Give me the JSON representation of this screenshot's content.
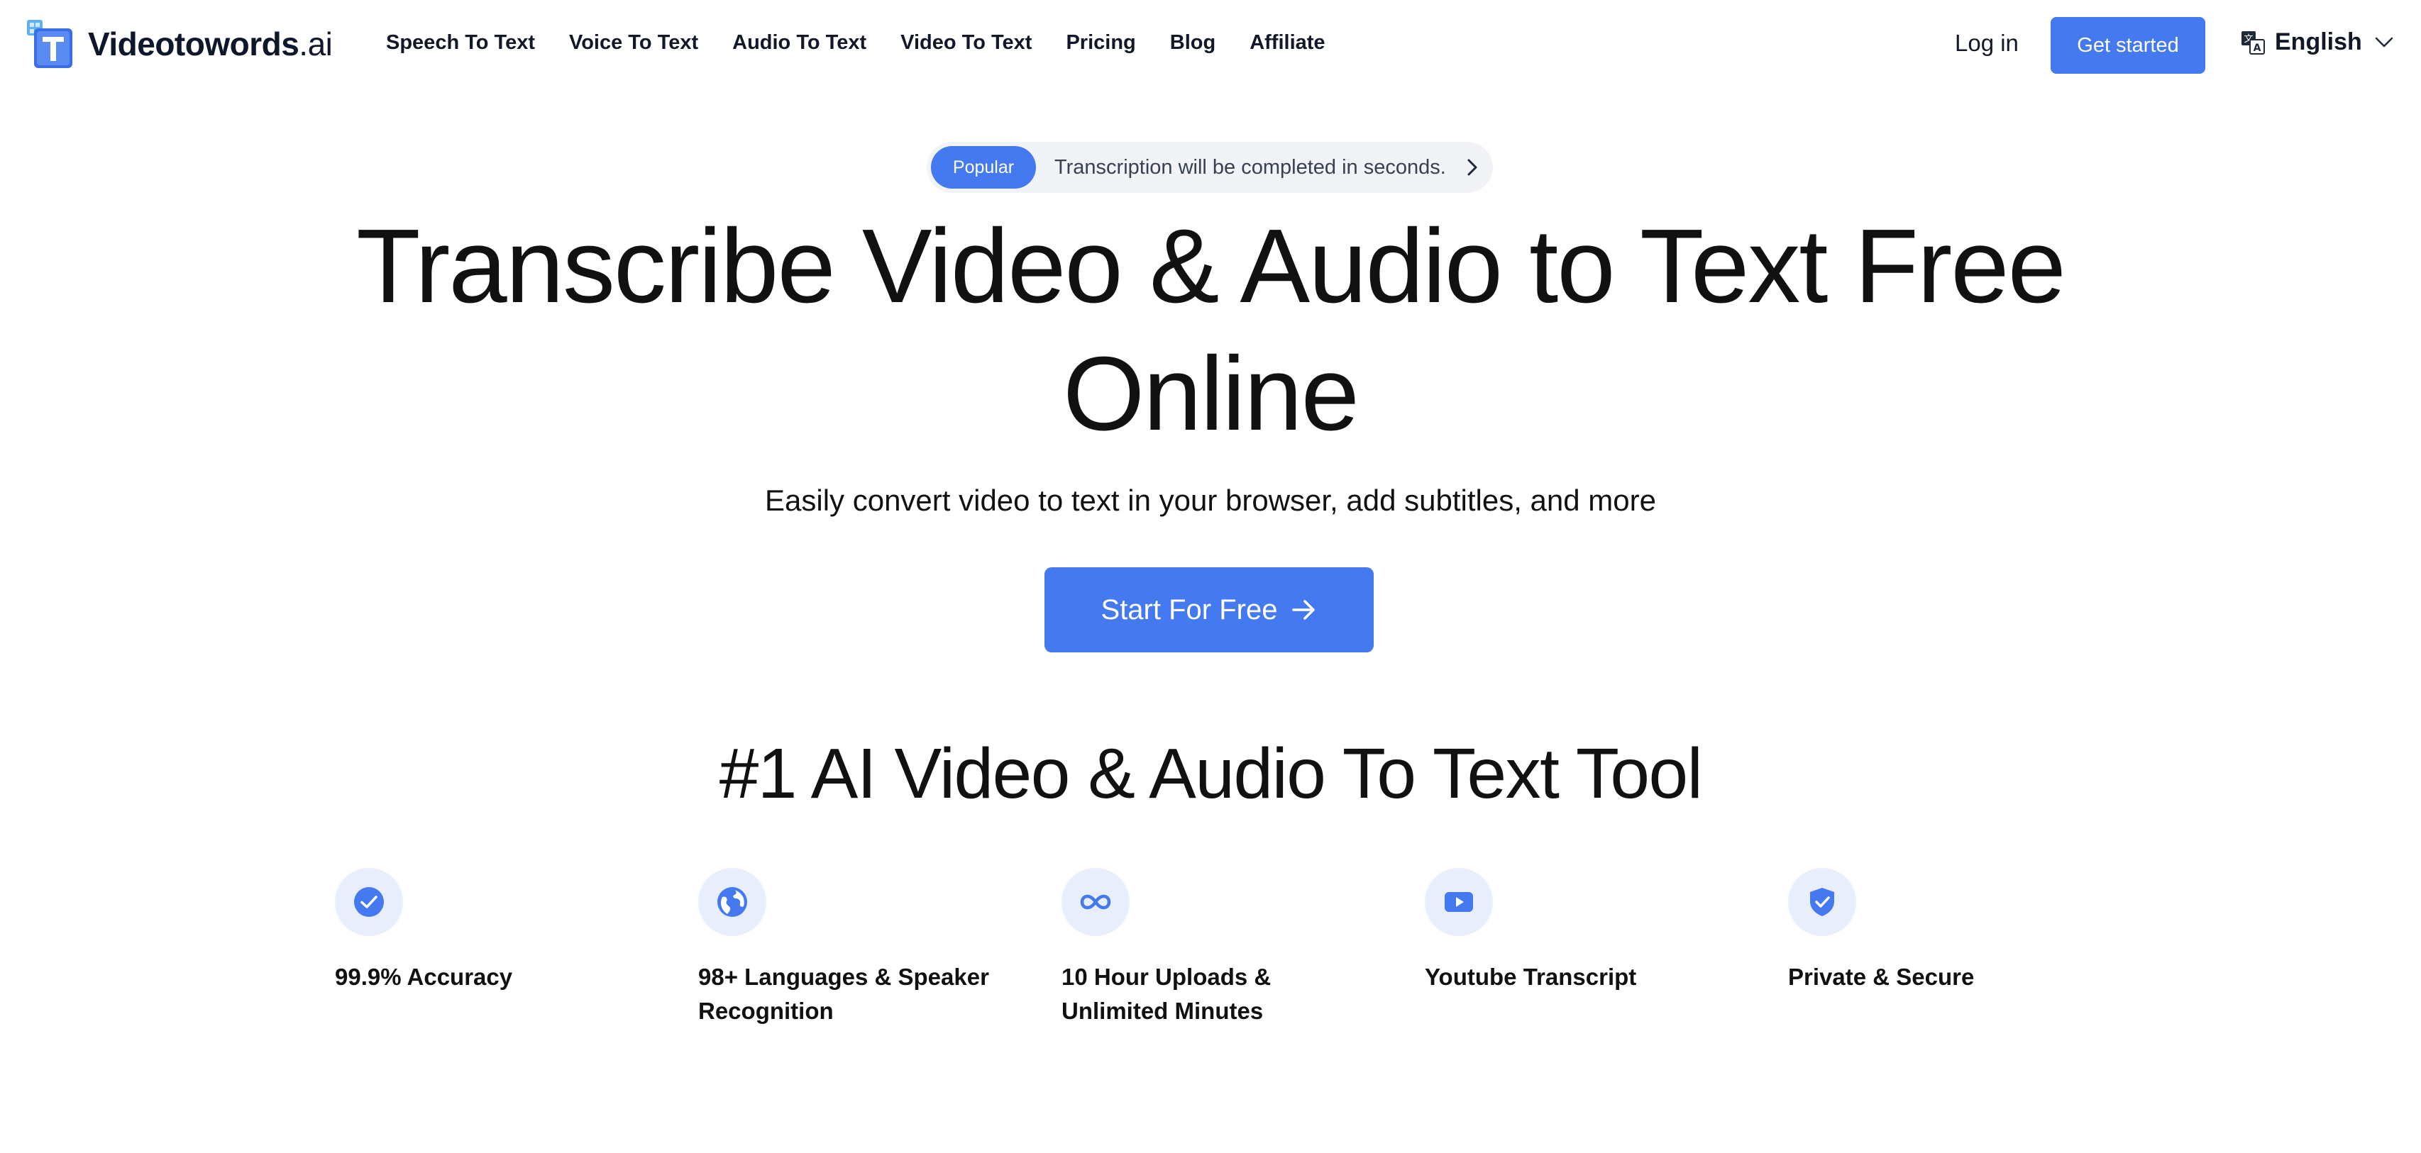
{
  "header": {
    "logo": {
      "name": "Videotowords",
      "suffix": ".ai"
    },
    "nav": [
      {
        "label": "Speech To Text"
      },
      {
        "label": "Voice To Text"
      },
      {
        "label": "Audio To Text"
      },
      {
        "label": "Video To Text"
      },
      {
        "label": "Pricing"
      },
      {
        "label": "Blog"
      },
      {
        "label": "Affiliate"
      }
    ],
    "login_label": "Log in",
    "get_started_label": "Get started",
    "language": {
      "icon": "translate-icon",
      "selected": "English"
    }
  },
  "hero": {
    "announcement": {
      "badge": "Popular",
      "text": "Transcription will be completed in seconds."
    },
    "title_line1": "Transcribe Video & Audio to Text Free",
    "title_line2": "Online",
    "subtitle": "Easily convert video to text in your browser, add subtitles, and more",
    "cta_label": "Start For Free"
  },
  "features_section": {
    "title": "#1 AI Video & Audio To Text Tool",
    "items": [
      {
        "icon": "check-circle-icon",
        "label_line1": "99.9% Accuracy",
        "label_line2": ""
      },
      {
        "icon": "globe-icon",
        "label_line1": "98+ Languages & Speaker",
        "label_line2": "Recognition"
      },
      {
        "icon": "infinity-icon",
        "label_line1": "10 Hour Uploads &",
        "label_line2": "Unlimited Minutes"
      },
      {
        "icon": "youtube-play-icon",
        "label_line1": "Youtube Transcript",
        "label_line2": ""
      },
      {
        "icon": "shield-check-icon",
        "label_line1": "Private & Secure",
        "label_line2": ""
      }
    ]
  },
  "colors": {
    "accent": "#4479f0",
    "icon_bg": "#e8eefb",
    "text": "#111111",
    "pill_bg": "#f1f3f6"
  }
}
